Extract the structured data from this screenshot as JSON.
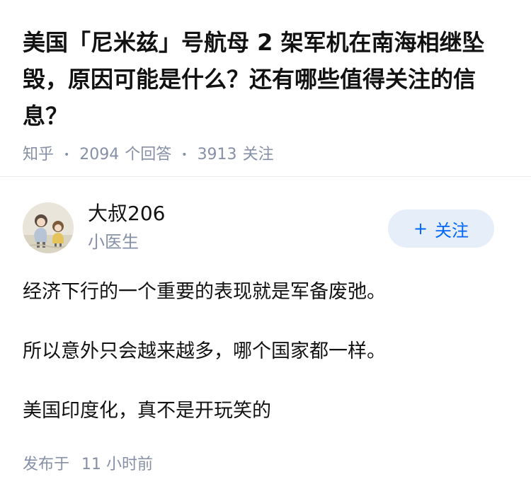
{
  "question": {
    "title": "美国「尼米兹」号航母 2 架军机在南海相继坠毁，原因可能是什么？还有哪些值得关注的信息？",
    "source": "知乎",
    "answer_count": "2094",
    "answer_label": "个回答",
    "follower_count": "3913",
    "follower_label": "关注"
  },
  "author": {
    "name": "大叔206",
    "bio": "小医生",
    "follow_label": "关注"
  },
  "answer": {
    "paragraphs": [
      "经济下行的一个重要的表现就是军备废弛。",
      "所以意外只会越来越多，哪个国家都一样。",
      "美国印度化，真不是开玩笑的"
    ],
    "time_prefix": "发布于",
    "time_value": "11 小时前"
  },
  "colors": {
    "primary_text": "#121212",
    "meta_text": "#8590a6",
    "accent": "#0066ff",
    "follow_bg": "#e5eef9"
  }
}
